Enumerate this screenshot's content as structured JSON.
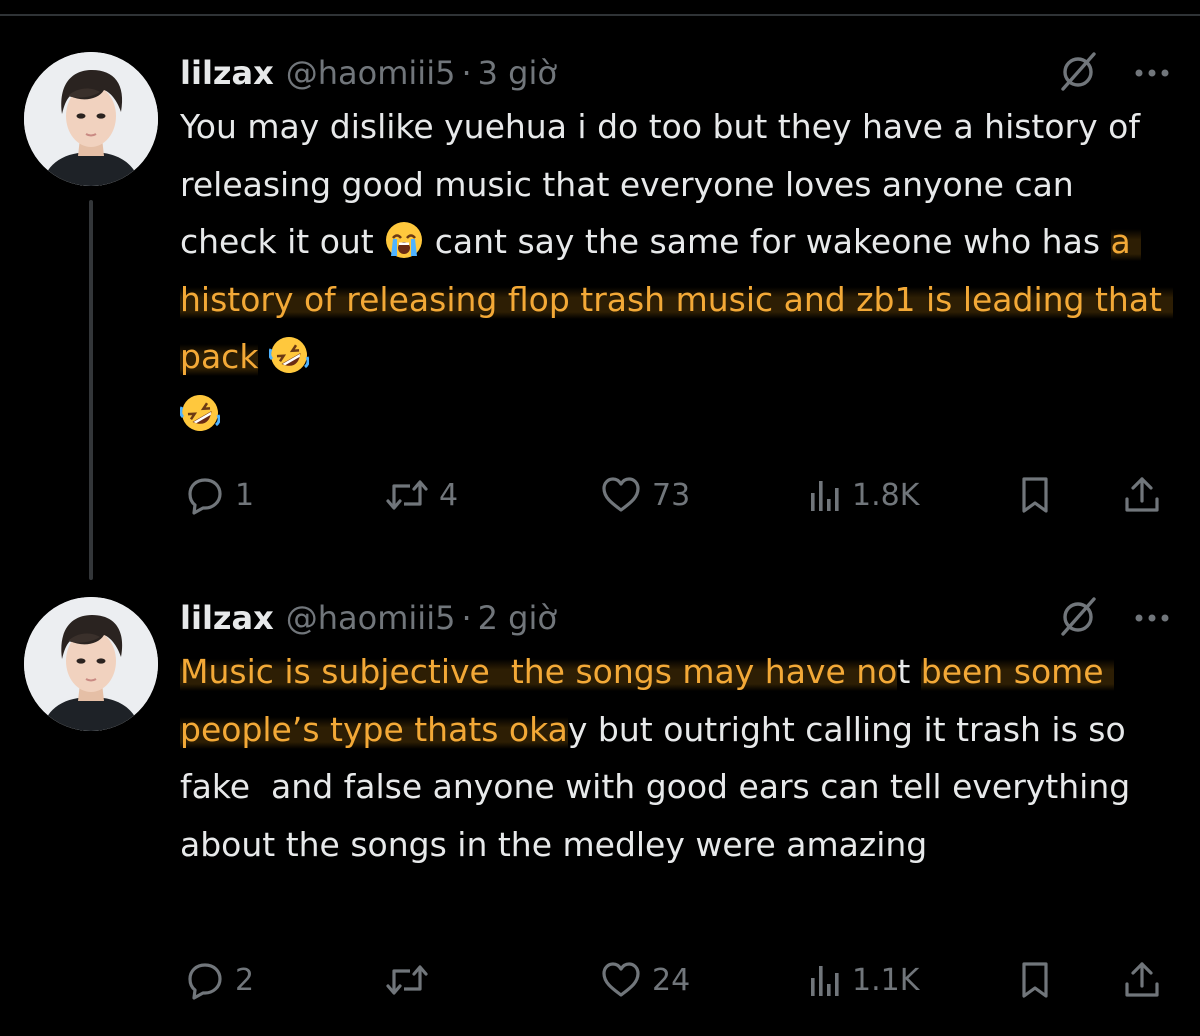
{
  "tweets": [
    {
      "display_name": "lilzax",
      "handle": "@haomiii5",
      "separator": "·",
      "time": "3 giờ",
      "text_plain_1": "You may dislike yuehua i do too but they have a history of releasing good music that everyone loves anyone can check it out ",
      "emoji_1": "loudly-crying-face",
      "text_plain_2": " cant say the same for wakeone who has ",
      "text_highlight_1": "a history of releasing flop trash music and zb1 is leading that pack",
      "text_plain_3": " ",
      "emoji_2": "rolling-on-the-floor-laughing",
      "emoji_3": "rolling-on-the-floor-laughing",
      "replies": "1",
      "retweets": "4",
      "likes": "73",
      "views": "1.8K"
    },
    {
      "display_name": "lilzax",
      "handle": "@haomiii5",
      "separator": "·",
      "time": "2 giờ",
      "text_highlight_1": "Music is subjective  the songs may have no",
      "text_plain_1": "t ",
      "text_highlight_2": "been some people’s type thats oka",
      "text_plain_2": "y but outright calling it trash is so fake  and false anyone with good ears can tell everything about the songs in the medley were amazing",
      "replies": "2",
      "retweets": "",
      "likes": "24",
      "views": "1.1K"
    }
  ],
  "colors": {
    "background": "#000000",
    "text": "#e7e9ea",
    "muted": "#71767b",
    "highlight_text": "#f3a937",
    "divider": "#2f3336"
  },
  "icons": {
    "reply": "reply-icon",
    "retweet": "retweet-icon",
    "like": "heart-icon",
    "views": "views-icon",
    "bookmark": "bookmark-icon",
    "share": "share-icon",
    "grok": "grok-icon",
    "more": "more-icon"
  }
}
